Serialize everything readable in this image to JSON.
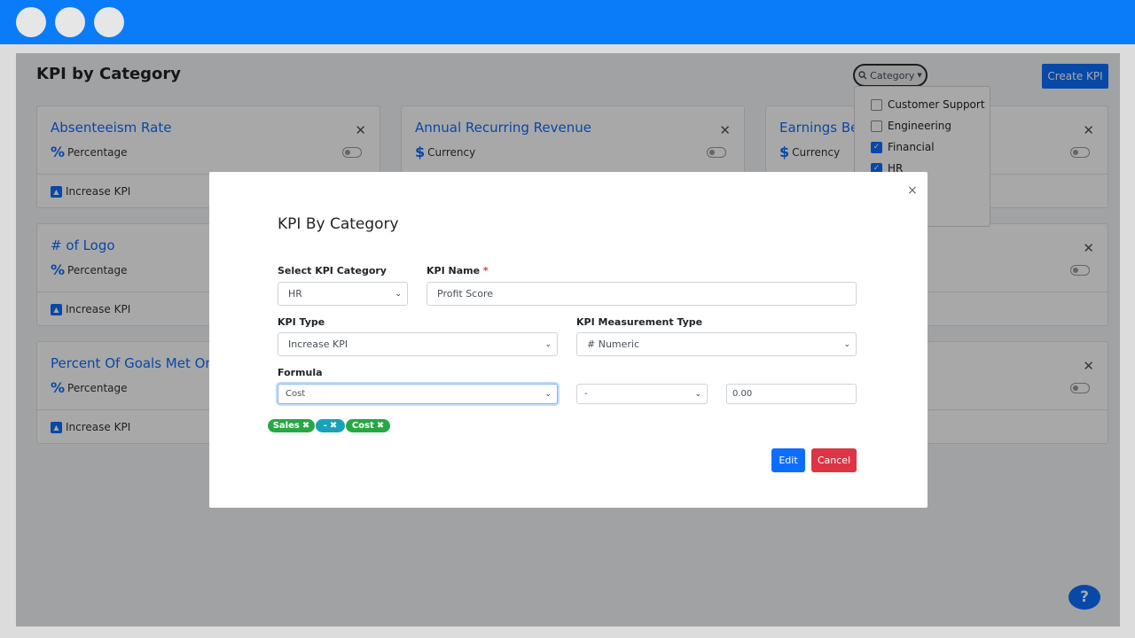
{
  "window": {
    "controls": [
      "circle",
      "circle",
      "circle"
    ]
  },
  "page": {
    "title": "KPI by Category",
    "category_filter_label": "Category",
    "create_button": "Create KPI"
  },
  "dropdown": {
    "items": [
      {
        "label": "Customer Support",
        "checked": false
      },
      {
        "label": "Engineering",
        "checked": false
      },
      {
        "label": "Financial",
        "checked": true
      },
      {
        "label": "HR",
        "checked": true
      }
    ]
  },
  "cards": [
    {
      "title": "Absenteeism Rate",
      "type_symbol": "%",
      "type_label": "Percentage",
      "kpi_type": "Increase KPI"
    },
    {
      "title": "Annual Recurring Revenue",
      "type_symbol": "$",
      "type_label": "Currency",
      "kpi_type": ""
    },
    {
      "title": "Earnings Bef",
      "type_symbol": "$",
      "type_label": "Currency",
      "kpi_type": ""
    },
    {
      "title": "# of Logo",
      "type_symbol": "%",
      "type_label": "Percentage",
      "kpi_type": "Increase KPI"
    },
    {
      "title": "Percent Of Goals Met Or E",
      "type_symbol": "%",
      "type_label": "Percentage",
      "kpi_type": "Increase KPI"
    }
  ],
  "modal": {
    "title": "KPI By Category",
    "close": "×",
    "select_category_label": "Select KPI Category",
    "select_category_value": "HR",
    "kpi_name_label": "KPI Name",
    "required_mark": "*",
    "kpi_name_value": "Profit Score",
    "kpi_type_label": "KPI Type",
    "kpi_type_value": "Increase KPI",
    "measurement_label": "KPI Measurement Type",
    "measurement_value": "# Numeric",
    "formula_label": "Formula",
    "formula_field_value": "Cost",
    "formula_operator_value": "-",
    "formula_number_value": "0.00",
    "chips": [
      {
        "label": "Sales",
        "color": "green"
      },
      {
        "label": "-",
        "color": "teal"
      },
      {
        "label": "Cost",
        "color": "green"
      }
    ],
    "edit_button": "Edit",
    "cancel_button": "Cancel"
  },
  "help_label": "?",
  "colors": {
    "accent": "#0d6efd",
    "topbar": "#0a7cf9",
    "danger": "#dc3545",
    "success": "#28a745",
    "info": "#17a2b8"
  }
}
